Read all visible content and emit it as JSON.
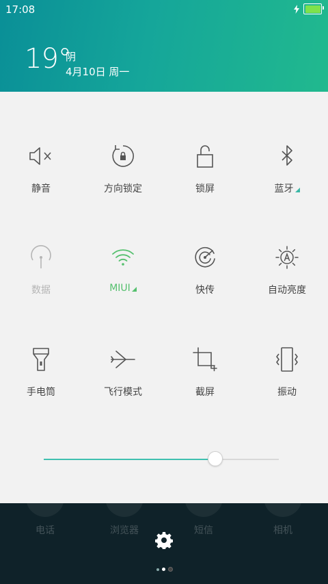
{
  "status": {
    "time": "17:08"
  },
  "weather": {
    "temperature": "19°",
    "condition": "阴",
    "date": "4月10日 周一"
  },
  "toggles": [
    {
      "label": "静音",
      "icon": "mute-icon",
      "state": "normal"
    },
    {
      "label": "方向锁定",
      "icon": "rotation-lock-icon",
      "state": "normal"
    },
    {
      "label": "锁屏",
      "icon": "unlock-icon",
      "state": "normal"
    },
    {
      "label": "蓝牙",
      "icon": "bluetooth-icon",
      "state": "normal",
      "has_more": true
    },
    {
      "label": "数据",
      "icon": "mobile-data-icon",
      "state": "disabled"
    },
    {
      "label": "MIUI",
      "icon": "wifi-icon",
      "state": "active",
      "has_more": true
    },
    {
      "label": "快传",
      "icon": "quick-transfer-icon",
      "state": "normal"
    },
    {
      "label": "自动亮度",
      "icon": "auto-brightness-icon",
      "state": "normal"
    },
    {
      "label": "手电筒",
      "icon": "flashlight-icon",
      "state": "normal"
    },
    {
      "label": "飞行模式",
      "icon": "airplane-icon",
      "state": "normal"
    },
    {
      "label": "截屏",
      "icon": "screenshot-crop-icon",
      "state": "normal"
    },
    {
      "label": "振动",
      "icon": "vibrate-icon",
      "state": "normal"
    }
  ],
  "brightness": {
    "level": 0.73
  },
  "dock": [
    {
      "label": "电话"
    },
    {
      "label": "浏览器"
    },
    {
      "label": "短信"
    },
    {
      "label": "相机"
    }
  ],
  "colors": {
    "accent": "#3fc0b0",
    "active": "#55c06e",
    "icon": "#555555",
    "disabled": "#b5b5b5"
  }
}
